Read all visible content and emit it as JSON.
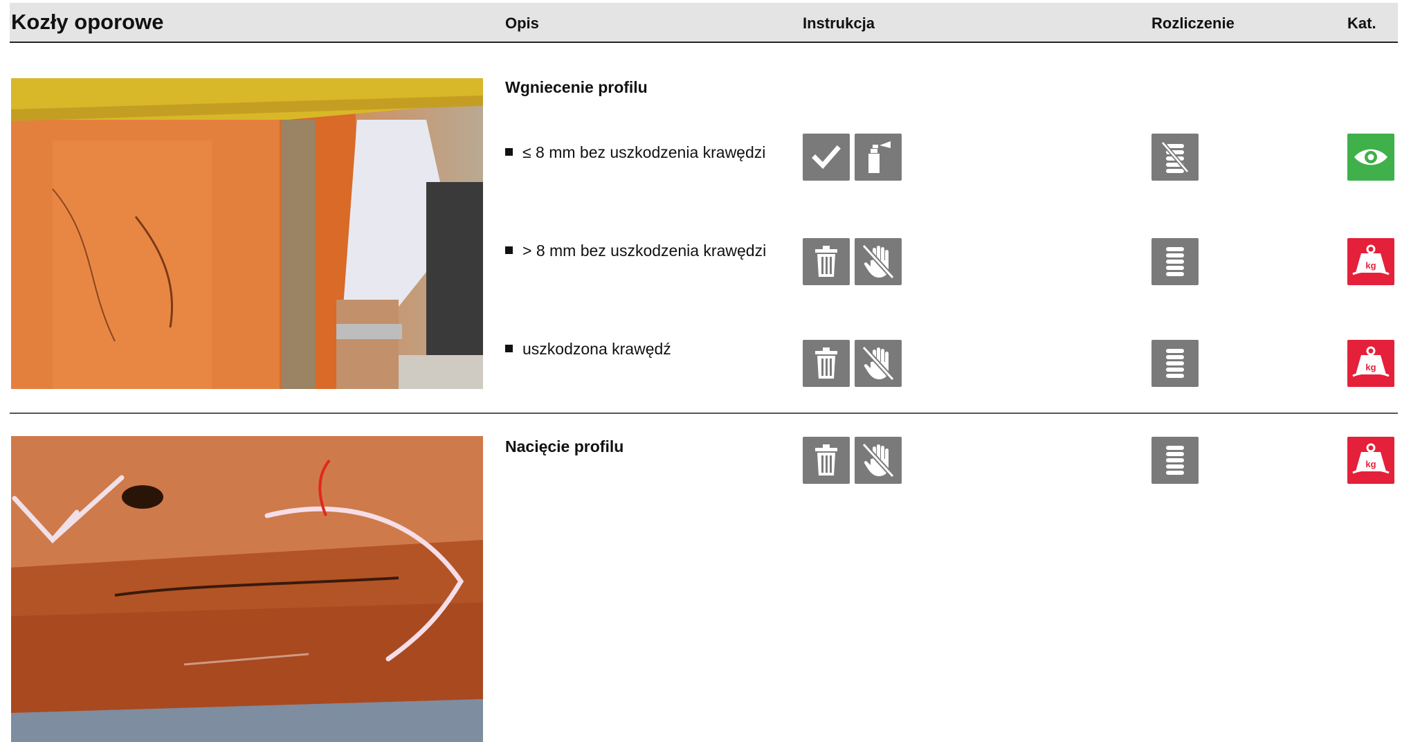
{
  "header": {
    "title": "Kozły oporowe",
    "col_description": "Opis",
    "col_instruction": "Instrukcja",
    "col_settlement": "Rozliczenie",
    "col_category": "Kat."
  },
  "sections": [
    {
      "title": "Wgniecenie profilu",
      "photo_icon": "photo-measuring-dent",
      "rows": [
        {
          "text": "≤ 8 mm bez uszkodzenia krawędzi",
          "instruction_icons": [
            "check-icon",
            "spray-paint-icon"
          ],
          "settlement_icon": "no-coins-icon",
          "category_icon": "eye-icon",
          "category_color": "#3fb04a"
        },
        {
          "text": "> 8 mm bez uszkodzenia krawędzi",
          "instruction_icons": [
            "trash-icon",
            "no-hand-icon"
          ],
          "settlement_icon": "coins-icon",
          "category_icon": "weight-kg-icon",
          "category_color": "#e5203a",
          "category_text": "kg"
        },
        {
          "text": "uszkodzona krawędź",
          "instruction_icons": [
            "trash-icon",
            "no-hand-icon"
          ],
          "settlement_icon": "coins-icon",
          "category_icon": "weight-kg-icon",
          "category_color": "#e5203a",
          "category_text": "kg"
        }
      ]
    },
    {
      "title": "Nacięcie profilu",
      "photo_icon": "photo-rusty-profile-cut",
      "instruction_icons": [
        "trash-icon",
        "no-hand-icon"
      ],
      "settlement_icon": "coins-icon",
      "category_icon": "weight-kg-icon",
      "category_color": "#e5203a",
      "category_text": "kg"
    }
  ],
  "colors": {
    "icon_grey": "#7a7a7a",
    "header_bg": "#e4e4e4"
  }
}
